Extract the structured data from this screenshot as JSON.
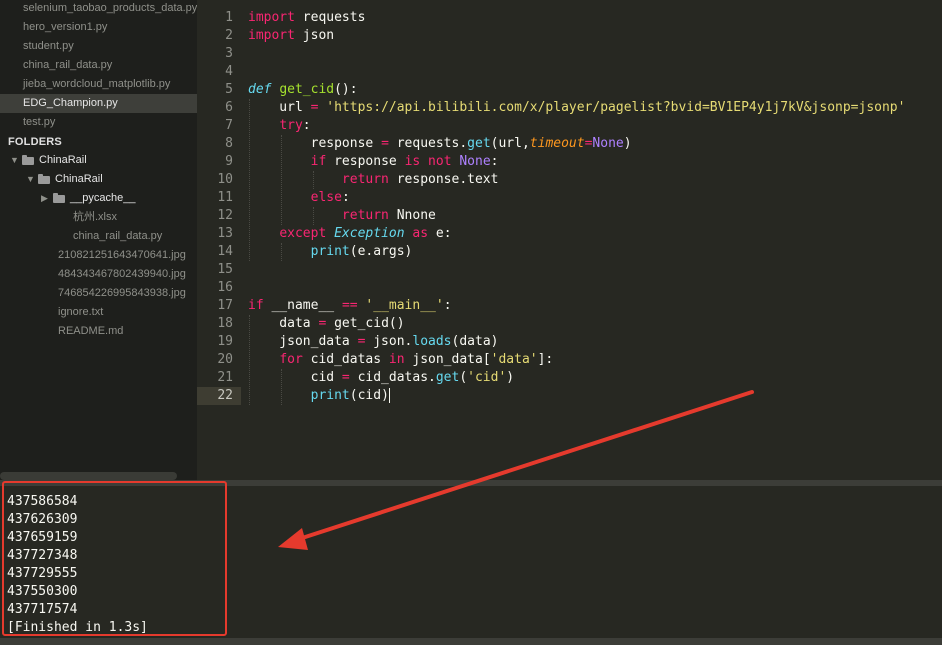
{
  "sidebar": {
    "open_files": [
      "selenium_taobao_products_data.py",
      "hero_version1.py",
      "student.py",
      "china_rail_data.py",
      "jieba_wordcloud_matplotlib.py",
      "EDG_Champion.py",
      "test.py"
    ],
    "active_file_index": 5,
    "folders_title": "FOLDERS",
    "tree": [
      {
        "label": "ChinaRail",
        "type": "folder",
        "level": 0
      },
      {
        "label": "ChinaRail",
        "type": "folder",
        "level": 1
      },
      {
        "label": "__pycache__",
        "type": "folder-collapsed",
        "level": 2
      },
      {
        "label": "杭州.xlsx",
        "type": "file",
        "level": 3
      },
      {
        "label": "china_rail_data.py",
        "type": "file",
        "level": 3
      },
      {
        "label": "210821251643470641.jpg",
        "type": "file",
        "level": 2
      },
      {
        "label": "484343467802439940.jpg",
        "type": "file",
        "level": 2
      },
      {
        "label": "746854226995843938.jpg",
        "type": "file",
        "level": 2
      },
      {
        "label": "ignore.txt",
        "type": "file",
        "level": 2
      },
      {
        "label": "README.md",
        "type": "file",
        "level": 2
      }
    ]
  },
  "editor": {
    "current_line": 22,
    "line_numbers": [
      "1",
      "2",
      "3",
      "4",
      "5",
      "6",
      "7",
      "8",
      "9",
      "10",
      "11",
      "12",
      "13",
      "14",
      "15",
      "16",
      "17",
      "18",
      "19",
      "20",
      "21",
      "22"
    ],
    "code_lines": [
      "import requests",
      "import json",
      "",
      "",
      "def get_cid():",
      "    url = 'https://api.bilibili.com/x/player/pagelist?bvid=BV1EP4y1j7kV&jsonp=jsonp'",
      "    try:",
      "        response = requests.get(url,timeout=None)",
      "        if response is not None:",
      "            return response.text",
      "        else:",
      "            return Nnone",
      "    except Exception as e:",
      "        print(e.args)",
      "",
      "",
      "if __name__ == '__main__':",
      "    data = get_cid()",
      "    json_data = json.loads(data)",
      "    for cid_datas in json_data['data']:",
      "        cid = cid_datas.get('cid')",
      "        print(cid)"
    ]
  },
  "console": {
    "output_lines": [
      "437586584",
      "437626309",
      "437659159",
      "437727348",
      "437729555",
      "437550300",
      "437717574",
      "[Finished in 1.3s]"
    ]
  },
  "colors": {
    "background": "#272822",
    "sidebar": "#1e1f1c",
    "annotation_red": "#e53a2d",
    "keyword": "#f92672",
    "function": "#a6e22e",
    "string": "#e6db74"
  }
}
